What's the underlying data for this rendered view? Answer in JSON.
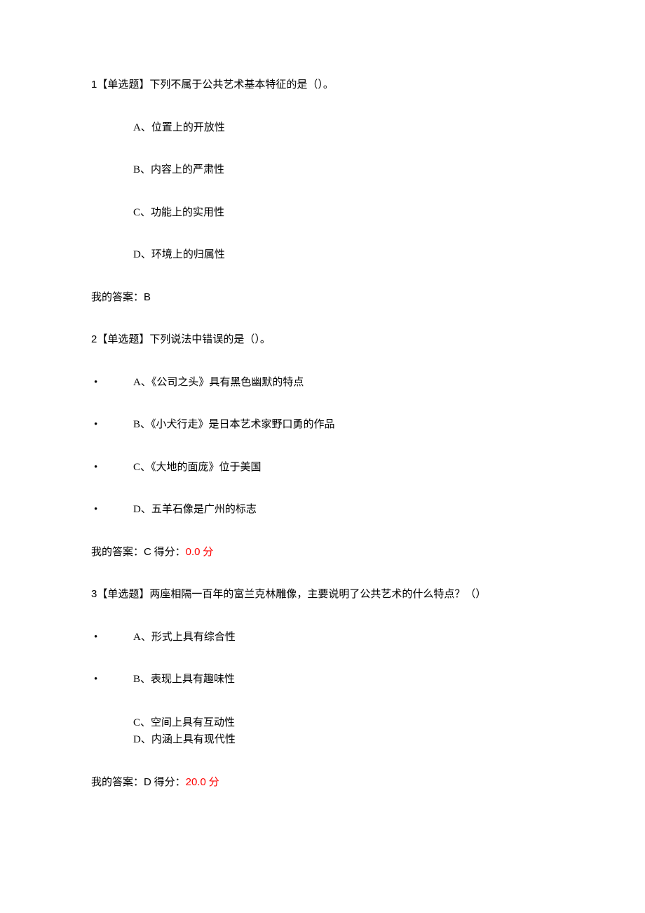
{
  "q1": {
    "prompt_num": "1",
    "prompt_tag": "【单选题】下列不属于公共艺术基本特征的是（）。",
    "a": "A、位置上的开放性",
    "b": "B、内容上的严肃性",
    "c": "C、功能上的实用性",
    "d": "D、环境上的归属性",
    "answer_label": "我的答案：",
    "answer_value": "B"
  },
  "q2": {
    "prompt_num": "2",
    "prompt_tag": "【单选题】下列说法中错误的是（）。",
    "a": "A、《公司之头》具有黑色幽默的特点",
    "b": "B、《小犬行走》是日本艺术家野口勇的作品",
    "c": "C、《大地的面庞》位于美国",
    "d": "D、五羊石像是广州的标志",
    "answer_label": "我的答案：",
    "answer_value": "C",
    "score_label": " 得分：",
    "score_value": "0.0",
    "score_unit": " 分"
  },
  "q3": {
    "prompt_num": "3",
    "prompt_tag": "【单选题】两座相隔一百年的富兰克林雕像，主要说明了公共艺术的什么特点？（）",
    "a": "A、形式上具有综合性",
    "b": "B、表现上具有趣味性",
    "c": "C、空间上具有互动性",
    "d": "D、内涵上具有现代性",
    "answer_label": "我的答案：",
    "answer_value": "D",
    "score_label": " 得分：",
    "score_value": "20.0",
    "score_unit": " 分"
  },
  "bullet": "•"
}
